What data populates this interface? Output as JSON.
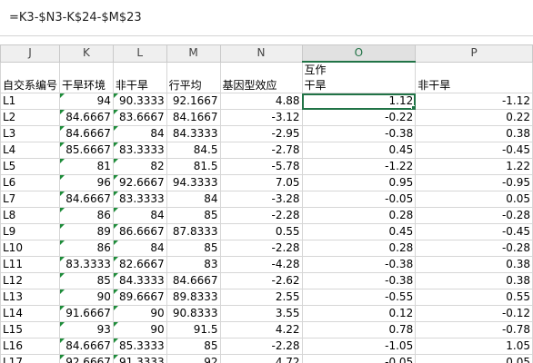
{
  "formula_bar": {
    "text": "=K3-$N3-K$24-$M$23"
  },
  "columns": [
    "J",
    "K",
    "L",
    "M",
    "N",
    "O",
    "P"
  ],
  "selected_column": "O",
  "header_row1": {
    "O": "互作"
  },
  "header_row2": [
    "自交系编号",
    "干旱环境",
    "非干旱",
    "行平均",
    "基因型效应",
    "干旱",
    "非干旱"
  ],
  "rows": [
    [
      "L1",
      "94",
      "90.3333",
      "92.1667",
      "4.88",
      "1.12",
      "-1.12"
    ],
    [
      "L2",
      "84.6667",
      "83.6667",
      "84.1667",
      "-3.12",
      "-0.22",
      "0.22"
    ],
    [
      "L3",
      "84.6667",
      "84",
      "84.3333",
      "-2.95",
      "-0.38",
      "0.38"
    ],
    [
      "L4",
      "85.6667",
      "83.3333",
      "84.5",
      "-2.78",
      "0.45",
      "-0.45"
    ],
    [
      "L5",
      "81",
      "82",
      "81.5",
      "-5.78",
      "-1.22",
      "1.22"
    ],
    [
      "L6",
      "96",
      "92.6667",
      "94.3333",
      "7.05",
      "0.95",
      "-0.95"
    ],
    [
      "L7",
      "84.6667",
      "83.3333",
      "84",
      "-3.28",
      "-0.05",
      "0.05"
    ],
    [
      "L8",
      "86",
      "84",
      "85",
      "-2.28",
      "0.28",
      "-0.28"
    ],
    [
      "L9",
      "89",
      "86.6667",
      "87.8333",
      "0.55",
      "0.45",
      "-0.45"
    ],
    [
      "L10",
      "86",
      "84",
      "85",
      "-2.28",
      "0.28",
      "-0.28"
    ],
    [
      "L11",
      "83.3333",
      "82.6667",
      "83",
      "-4.28",
      "-0.38",
      "0.38"
    ],
    [
      "L12",
      "85",
      "84.3333",
      "84.6667",
      "-2.62",
      "-0.38",
      "0.38"
    ],
    [
      "L13",
      "90",
      "89.6667",
      "89.8333",
      "2.55",
      "-0.55",
      "0.55"
    ],
    [
      "L14",
      "91.6667",
      "90",
      "90.8333",
      "3.55",
      "0.12",
      "-0.12"
    ],
    [
      "L15",
      "93",
      "90",
      "91.5",
      "4.22",
      "0.78",
      "-0.78"
    ],
    [
      "L16",
      "84.6667",
      "85.3333",
      "85",
      "-2.28",
      "-1.05",
      "1.05"
    ],
    [
      "L17",
      "92.6667",
      "91.3333",
      "92",
      "4.72",
      "-0.05",
      "0.05"
    ]
  ]
}
